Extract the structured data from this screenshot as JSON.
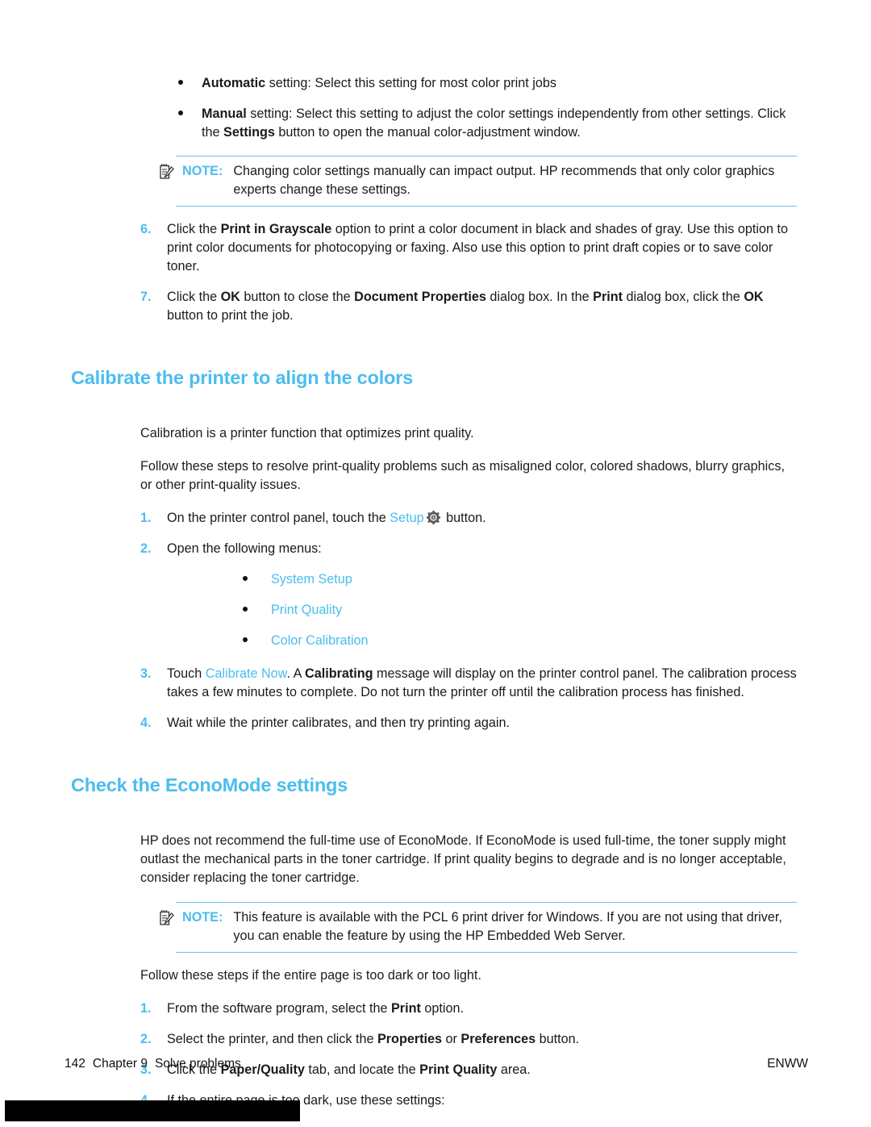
{
  "theme": {
    "accent_blue": "#4BBDEF",
    "rule_blue": "#62C4EE",
    "text": "#1c1c1c",
    "bar": "#000000"
  },
  "top_bullets": [
    {
      "bold_lead": "Automatic",
      "rest": " setting: Select this setting for most color print jobs"
    },
    {
      "bold_lead": "Manual",
      "rest_1": " setting: Select this setting to adjust the color settings independently from other settings. Click the ",
      "bold_mid": "Settings",
      "rest_2": " button to open the manual color-adjustment window."
    }
  ],
  "note_1": {
    "icon": "note-pad-pencil-icon",
    "label": "NOTE:",
    "text": "Changing color settings manually can impact output. HP recommends that only color graphics experts change these settings."
  },
  "steps_color": [
    {
      "num": "6.",
      "part_1": "Click the ",
      "bold_1": "Print in Grayscale",
      "part_2": " option to print a color document in black and shades of gray. Use this option to print color documents for photocopying or faxing. Also use this option to print draft copies or to save color toner."
    },
    {
      "num": "7.",
      "part_1": "Click the ",
      "bold_1": "OK",
      "part_2": " button to close the ",
      "bold_2": "Document Properties",
      "part_3": " dialog box. In the ",
      "bold_3": "Print",
      "part_4": " dialog box, click the ",
      "bold_4": "OK",
      "part_5": " button to print the job."
    }
  ],
  "section_calibrate": {
    "heading": "Calibrate the printer to align the colors",
    "para_1": "Calibration is a printer function that optimizes print quality.",
    "para_2": "Follow these steps to resolve print-quality problems such as misaligned color, colored shadows, blurry graphics, or other print-quality issues.",
    "step_1": {
      "num": "1.",
      "part_1": "On the printer control panel, touch the ",
      "link": "Setup",
      "icon": "gear-icon",
      "part_2": " button."
    },
    "step_2": {
      "num": "2.",
      "text": "Open the following menus:"
    },
    "menus": [
      "System Setup",
      "Print Quality",
      "Color Calibration"
    ],
    "step_3": {
      "num": "3.",
      "part_1": "Touch ",
      "link": "Calibrate Now",
      "part_2": ". A ",
      "bold_1": "Calibrating",
      "part_3": " message will display on the printer control panel. The calibration process takes a few minutes to complete. Do not turn the printer off until the calibration process has finished."
    },
    "step_4": {
      "num": "4.",
      "text": "Wait while the printer calibrates, and then try printing again."
    }
  },
  "section_economode": {
    "heading": "Check the EconoMode settings",
    "para_1": "HP does not recommend the full-time use of EconoMode. If EconoMode is used full-time, the toner supply might outlast the mechanical parts in the toner cartridge. If print quality begins to degrade and is no longer acceptable, consider replacing the toner cartridge.",
    "note": {
      "icon": "note-pad-pencil-icon",
      "label": "NOTE:",
      "text": "This feature is available with the PCL 6 print driver for Windows. If you are not using that driver, you can enable the feature by using the HP Embedded Web Server."
    },
    "para_2": "Follow these steps if the entire page is too dark or too light.",
    "steps": [
      {
        "num": "1.",
        "part_1": "From the software program, select the ",
        "bold_1": "Print",
        "part_2": " option."
      },
      {
        "num": "2.",
        "part_1": "Select the printer, and then click the ",
        "bold_1": "Properties",
        "part_2": " or ",
        "bold_2": "Preferences",
        "part_3": " button."
      },
      {
        "num": "3.",
        "part_1": "Click the ",
        "bold_1": "Paper/Quality",
        "part_2": " tab, and locate the ",
        "bold_2": "Print Quality",
        "part_3": " area."
      },
      {
        "num": "4.",
        "part_1": "If the entire page is too dark, use these settings:"
      }
    ]
  },
  "footer": {
    "page_number": "142",
    "chapter": "Chapter 9",
    "chapter_title": "Solve problems",
    "right": "ENWW"
  }
}
